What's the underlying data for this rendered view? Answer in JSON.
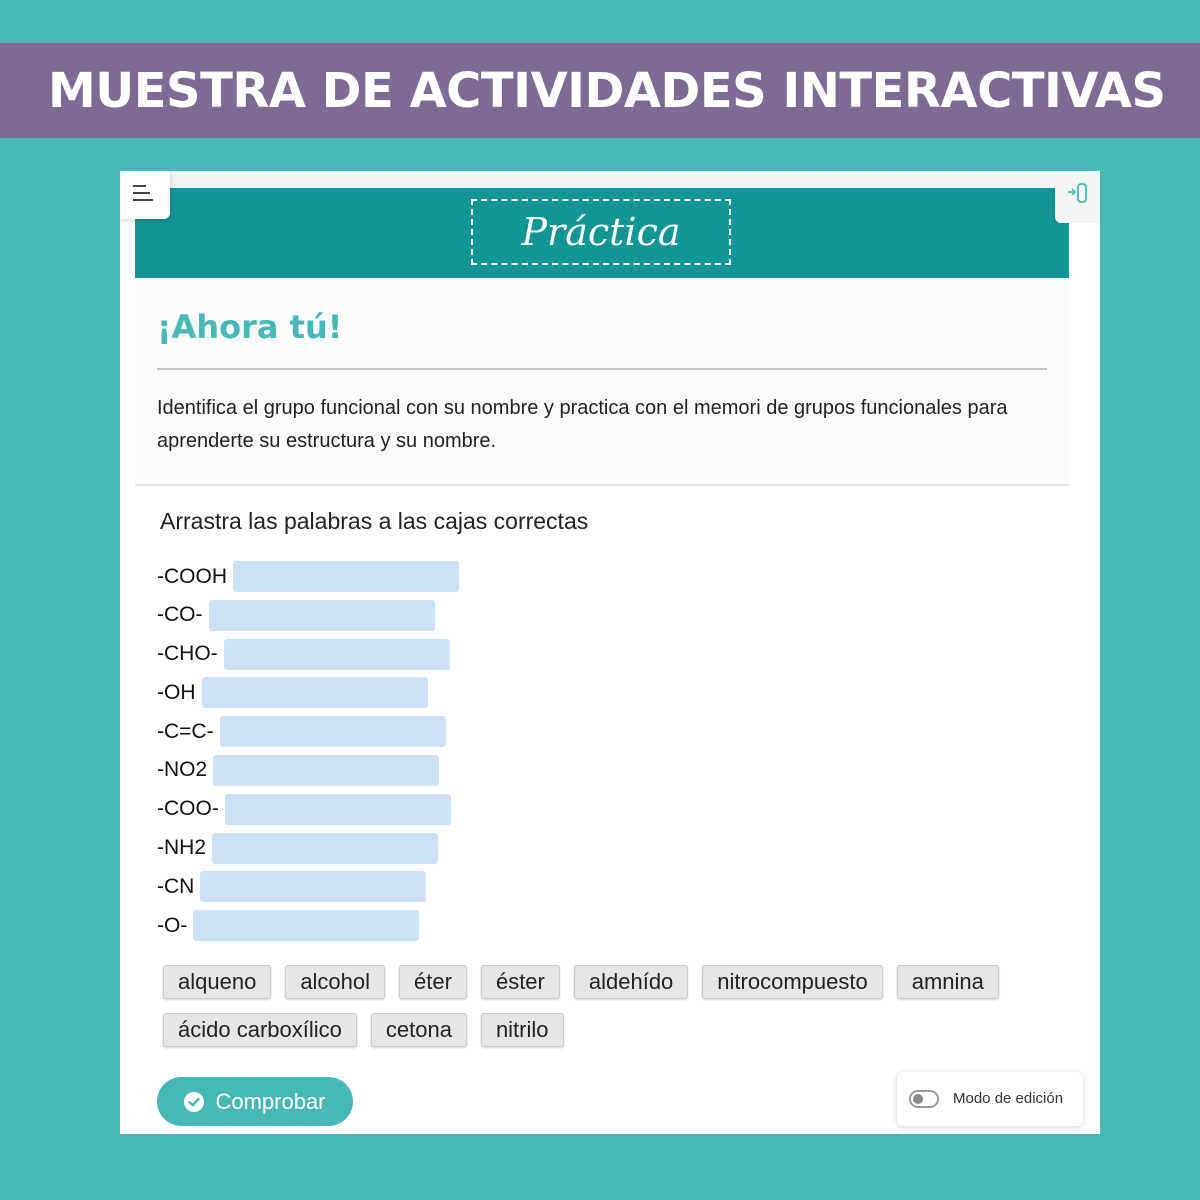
{
  "banner": {
    "title": "MUESTRA DE ACTIVIDADES INTERACTIVAS"
  },
  "header": {
    "title": "Práctica"
  },
  "icons": {
    "menu": "menu-lines-icon",
    "exit": "exit-door-icon",
    "check": "check-circle-icon"
  },
  "section": {
    "title": "¡Ahora tú!",
    "text": "Identifica el grupo funcional con su nombre y practica con el memori de grupos funcionales para aprenderte su estructura y su nombre."
  },
  "activity": {
    "prompt": "Arrastra las palabras a las cajas correctas",
    "items": [
      {
        "label": "-COOH"
      },
      {
        "label": "-CO-"
      },
      {
        "label": "-CHO-"
      },
      {
        "label": "-OH"
      },
      {
        "label": "-C=C-"
      },
      {
        "label": "-NO2"
      },
      {
        "label": "-COO-"
      },
      {
        "label": "-NH2"
      },
      {
        "label": "-CN"
      },
      {
        "label": "-O-"
      }
    ],
    "word_bank": [
      [
        "alqueno",
        "alcohol",
        "éter",
        "éster",
        "aldehído",
        "nitrocompuesto",
        "amnina"
      ],
      [
        "ácido carboxílico",
        "cetona",
        "nitrilo"
      ]
    ],
    "check_label": "Comprobar"
  },
  "edit_mode": {
    "label": "Modo de edición",
    "enabled": false
  },
  "colors": {
    "background": "#47b8b6",
    "banner": "#7d6b96",
    "header": "#129595",
    "accent": "#47b8b6",
    "drop_box": "#cde0f6",
    "chip": "#e6e6e6"
  }
}
